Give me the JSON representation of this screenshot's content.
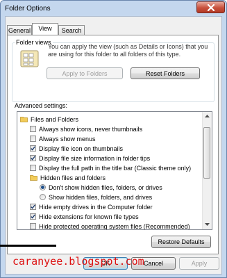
{
  "window": {
    "title": "Folder Options"
  },
  "tabs": [
    {
      "label": "General",
      "active": false
    },
    {
      "label": "View",
      "active": true
    },
    {
      "label": "Search",
      "active": false
    }
  ],
  "folder_views": {
    "title": "Folder views",
    "description": "You can apply the view (such as Details or Icons) that you are using for this folder to all folders of this type.",
    "apply_button": "Apply to Folders",
    "reset_button": "Reset Folders"
  },
  "advanced": {
    "label": "Advanced settings:",
    "items": [
      {
        "type": "folder",
        "label": "Files and Folders"
      },
      {
        "type": "checkbox",
        "checked": false,
        "label": "Always show icons, never thumbnails"
      },
      {
        "type": "checkbox",
        "checked": false,
        "label": "Always show menus"
      },
      {
        "type": "checkbox",
        "checked": true,
        "label": "Display file icon on thumbnails"
      },
      {
        "type": "checkbox",
        "checked": true,
        "label": "Display file size information in folder tips"
      },
      {
        "type": "checkbox",
        "checked": false,
        "label": "Display the full path in the title bar (Classic theme only)"
      },
      {
        "type": "folder",
        "label": "Hidden files and folders"
      },
      {
        "type": "radio",
        "checked": true,
        "label": "Don't show hidden files, folders, or drives"
      },
      {
        "type": "radio",
        "checked": false,
        "label": "Show hidden files, folders, and drives"
      },
      {
        "type": "checkbox",
        "checked": true,
        "label": "Hide empty drives in the Computer folder"
      },
      {
        "type": "checkbox",
        "checked": true,
        "label": "Hide extensions for known file types"
      },
      {
        "type": "checkbox",
        "checked": false,
        "label": "Hide protected operating system files (Recommended)"
      }
    ],
    "restore_button": "Restore Defaults"
  },
  "footer": {
    "ok": "OK",
    "cancel": "Cancel",
    "apply": "Apply"
  },
  "watermark": "caranyee.blogspot.com",
  "colors": {
    "frame": "#c4d7ee",
    "close_button": "#c8503c",
    "watermark": "#dd1111",
    "marker": "#000000"
  }
}
